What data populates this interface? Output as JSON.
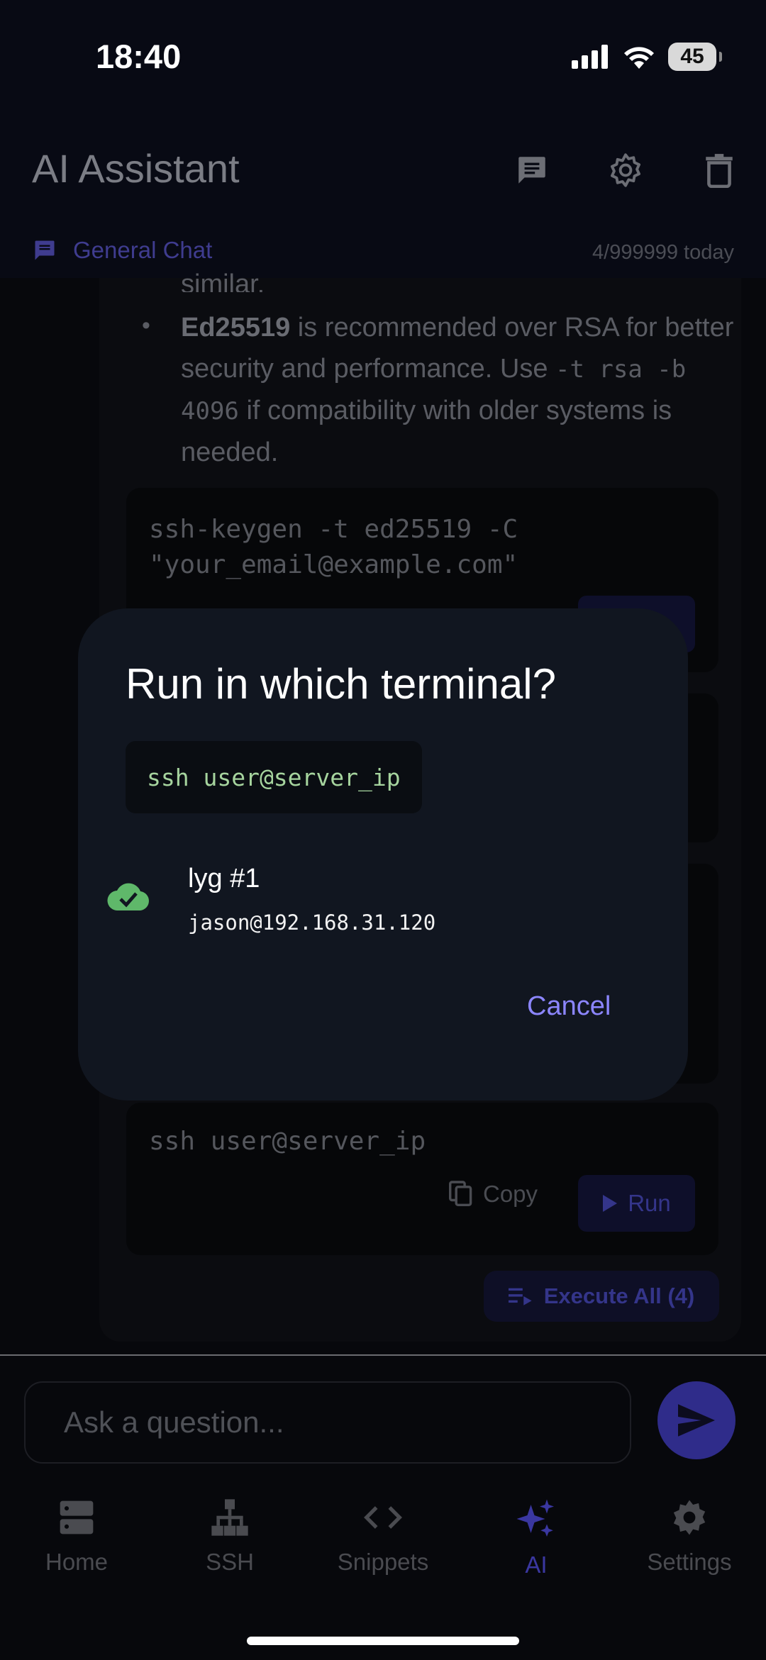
{
  "status_bar": {
    "time": "18:40",
    "battery": "45"
  },
  "header": {
    "title": "AI Assistant",
    "chat_name": "General Chat",
    "usage": "4/999999 today"
  },
  "message": {
    "truncated_line": "similar.",
    "bullet_bold": "Ed25519",
    "bullet_text_1": " is recommended over RSA for better security and performance. Use ",
    "bullet_code": "-t rsa -b 4096",
    "bullet_text_2": " if compatibility with older systems is needed.",
    "code_blocks": [
      {
        "code": "ssh-keygen -t ed25519 -C \"your_email@example.com\""
      },
      {
        "code": "ssh user@server_ip",
        "copy_label": "Copy",
        "run_label": "Run"
      }
    ],
    "execute_all_label": "Execute All (4)"
  },
  "input": {
    "placeholder": "Ask a question..."
  },
  "nav": {
    "items": [
      {
        "label": "Home",
        "icon": "server-icon"
      },
      {
        "label": "SSH",
        "icon": "network-icon"
      },
      {
        "label": "Snippets",
        "icon": "code-icon"
      },
      {
        "label": "AI",
        "icon": "sparkles-icon",
        "active": true
      },
      {
        "label": "Settings",
        "icon": "gear-icon"
      }
    ]
  },
  "dialog": {
    "title": "Run in which terminal?",
    "command": "ssh user@server_ip",
    "terminal_name": "lyg #1",
    "terminal_host": "jason@192.168.31.120",
    "cancel_label": "Cancel"
  },
  "colors": {
    "accent": "#8c86ff",
    "connected": "#5fb86a",
    "dialog_bg": "#111620"
  }
}
